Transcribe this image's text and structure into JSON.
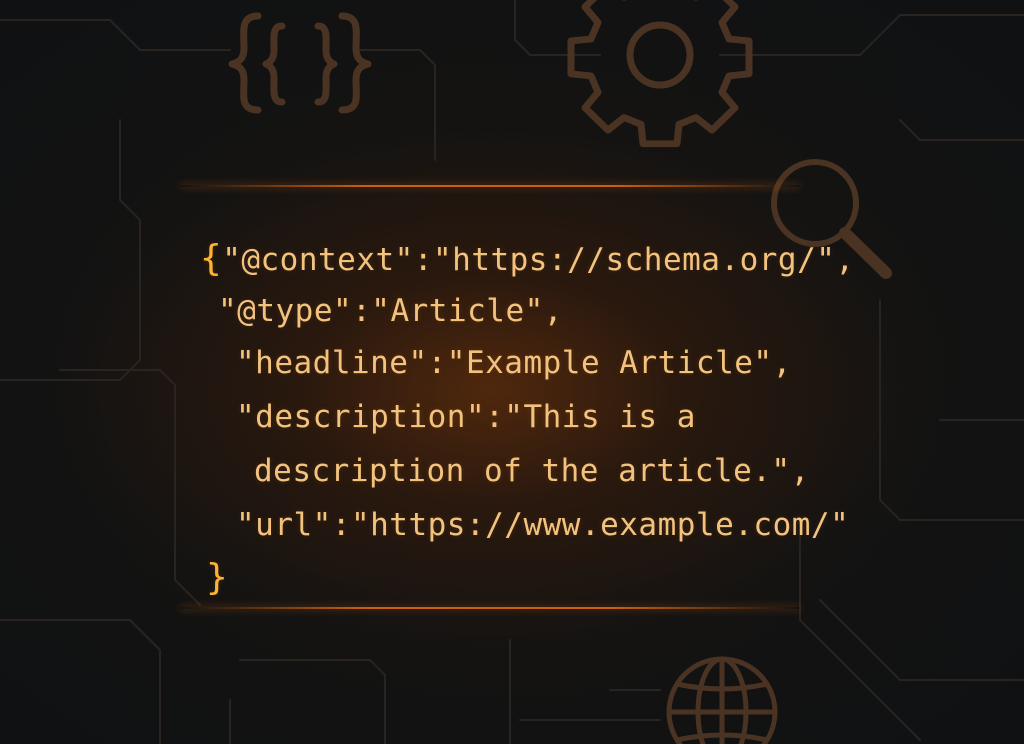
{
  "code": {
    "open_brace": "{",
    "line1": "\"@context\":\"https://schema.org/\",",
    "line2": "\"@type\":\"Article\",",
    "line3": "\"headline\":\"Example Article\",",
    "line4": "\"description\":\"This is a",
    "line5": "description of the article.\",",
    "line6": "\"url\":\"https://www.example.com/\"",
    "close_brace": "}"
  },
  "icons": [
    "curly-braces-icon",
    "gear-icon",
    "magnifier-icon",
    "globe-icon"
  ],
  "colors": {
    "background": "#101214",
    "code_text": "#f3c37e",
    "brace": "#ffb32e",
    "accent_glow": "#e66e14",
    "icon": "#4a3322"
  }
}
